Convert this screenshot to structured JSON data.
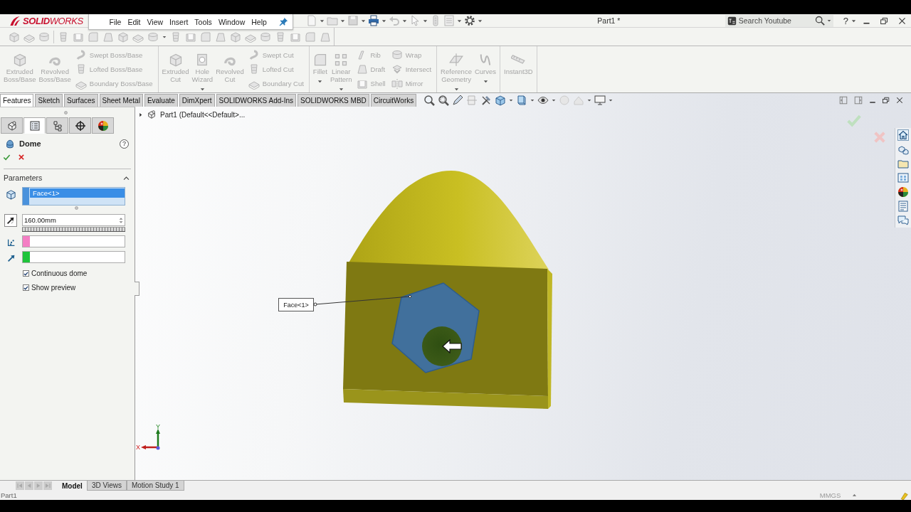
{
  "title_bar": {
    "logo": "**SOLID**WORKS",
    "menu": [
      "File",
      "Edit",
      "View",
      "Insert",
      "Tools",
      "Window",
      "Help"
    ],
    "document_title": "Part1 *",
    "search": {
      "placeholder": "Search Youtube"
    },
    "help": "?"
  },
  "command_manager": {
    "disabled": true,
    "groups": [
      {
        "large": [
          {
            "label": "Extruded Boss/Base",
            "dropdown": false
          },
          {
            "label": "Revolved Boss/Base",
            "dropdown": false
          }
        ],
        "columns": [
          [
            "Swept Boss/Base",
            "Lofted Boss/Base",
            "Boundary Boss/Base"
          ]
        ]
      },
      {
        "large": [
          {
            "label": "Extruded Cut",
            "dropdown": false
          },
          {
            "label": "Hole Wizard",
            "dropdown": true
          },
          {
            "label": "Revolved Cut",
            "dropdown": false
          }
        ],
        "columns": [
          [
            "Swept Cut",
            "Lofted Cut",
            "Boundary Cut"
          ]
        ]
      },
      {
        "large": [
          {
            "label": "Fillet",
            "dropdown": true
          },
          {
            "label": "Linear Pattern",
            "dropdown": true
          }
        ],
        "columns": [
          [
            "Rib",
            "Draft",
            "Shell"
          ],
          [
            "Wrap",
            "Intersect",
            "Mirror"
          ]
        ]
      },
      {
        "large": [
          {
            "label": "Reference Geometry",
            "dropdown": true
          },
          {
            "label": "Curves",
            "dropdown": true
          }
        ]
      },
      {
        "large": [
          {
            "label": "Instant3D",
            "dropdown": false
          }
        ]
      }
    ]
  },
  "tabs": [
    {
      "label": "Features",
      "selected": true
    },
    {
      "label": "Sketch",
      "selected": false
    },
    {
      "label": "Surfaces",
      "selected": false
    },
    {
      "label": "Sheet Metal",
      "selected": false
    },
    {
      "label": "Evaluate",
      "selected": false
    },
    {
      "label": "DimXpert",
      "selected": false
    },
    {
      "label": "SOLIDWORKS Add-Ins",
      "selected": false
    },
    {
      "label": "SOLIDWORKS MBD",
      "selected": false
    },
    {
      "label": "CircuitWorks",
      "selected": false
    }
  ],
  "property_manager": {
    "manager_tabs": [
      {
        "kind": "feature_tree",
        "selected": false
      },
      {
        "kind": "property",
        "selected": true
      },
      {
        "kind": "configuration",
        "selected": false
      },
      {
        "kind": "dimxpert",
        "selected": false
      },
      {
        "kind": "display",
        "selected": false
      }
    ],
    "title": "Dome",
    "help": "?",
    "section": {
      "title": "Parameters",
      "expanded": true
    },
    "faces": [
      {
        "label": "Face<1>",
        "selected": true
      }
    ],
    "fields": [
      {
        "kind": "distance",
        "value": "160.00mm"
      },
      {
        "kind": "constraint_point",
        "color": "#f47ec4"
      },
      {
        "kind": "direction",
        "color": "#1ec43a"
      }
    ],
    "options": [
      {
        "label": "Continuous dome",
        "checked": true
      },
      {
        "label": "Show preview",
        "checked": true
      }
    ]
  },
  "graphics": {
    "tree_flyout": {
      "label": "Part1 (Default<<Default>...",
      "expanded": false
    },
    "callout": "Face<1>",
    "triad": {
      "x": "X",
      "y": "Y"
    }
  },
  "bottom_tabs": [
    {
      "label": "Model",
      "selected": true
    },
    {
      "label": "3D Views",
      "selected": false
    },
    {
      "label": "Motion Study 1",
      "selected": false
    }
  ],
  "status_bar": {
    "document": "Part1",
    "units": "MMGS"
  }
}
